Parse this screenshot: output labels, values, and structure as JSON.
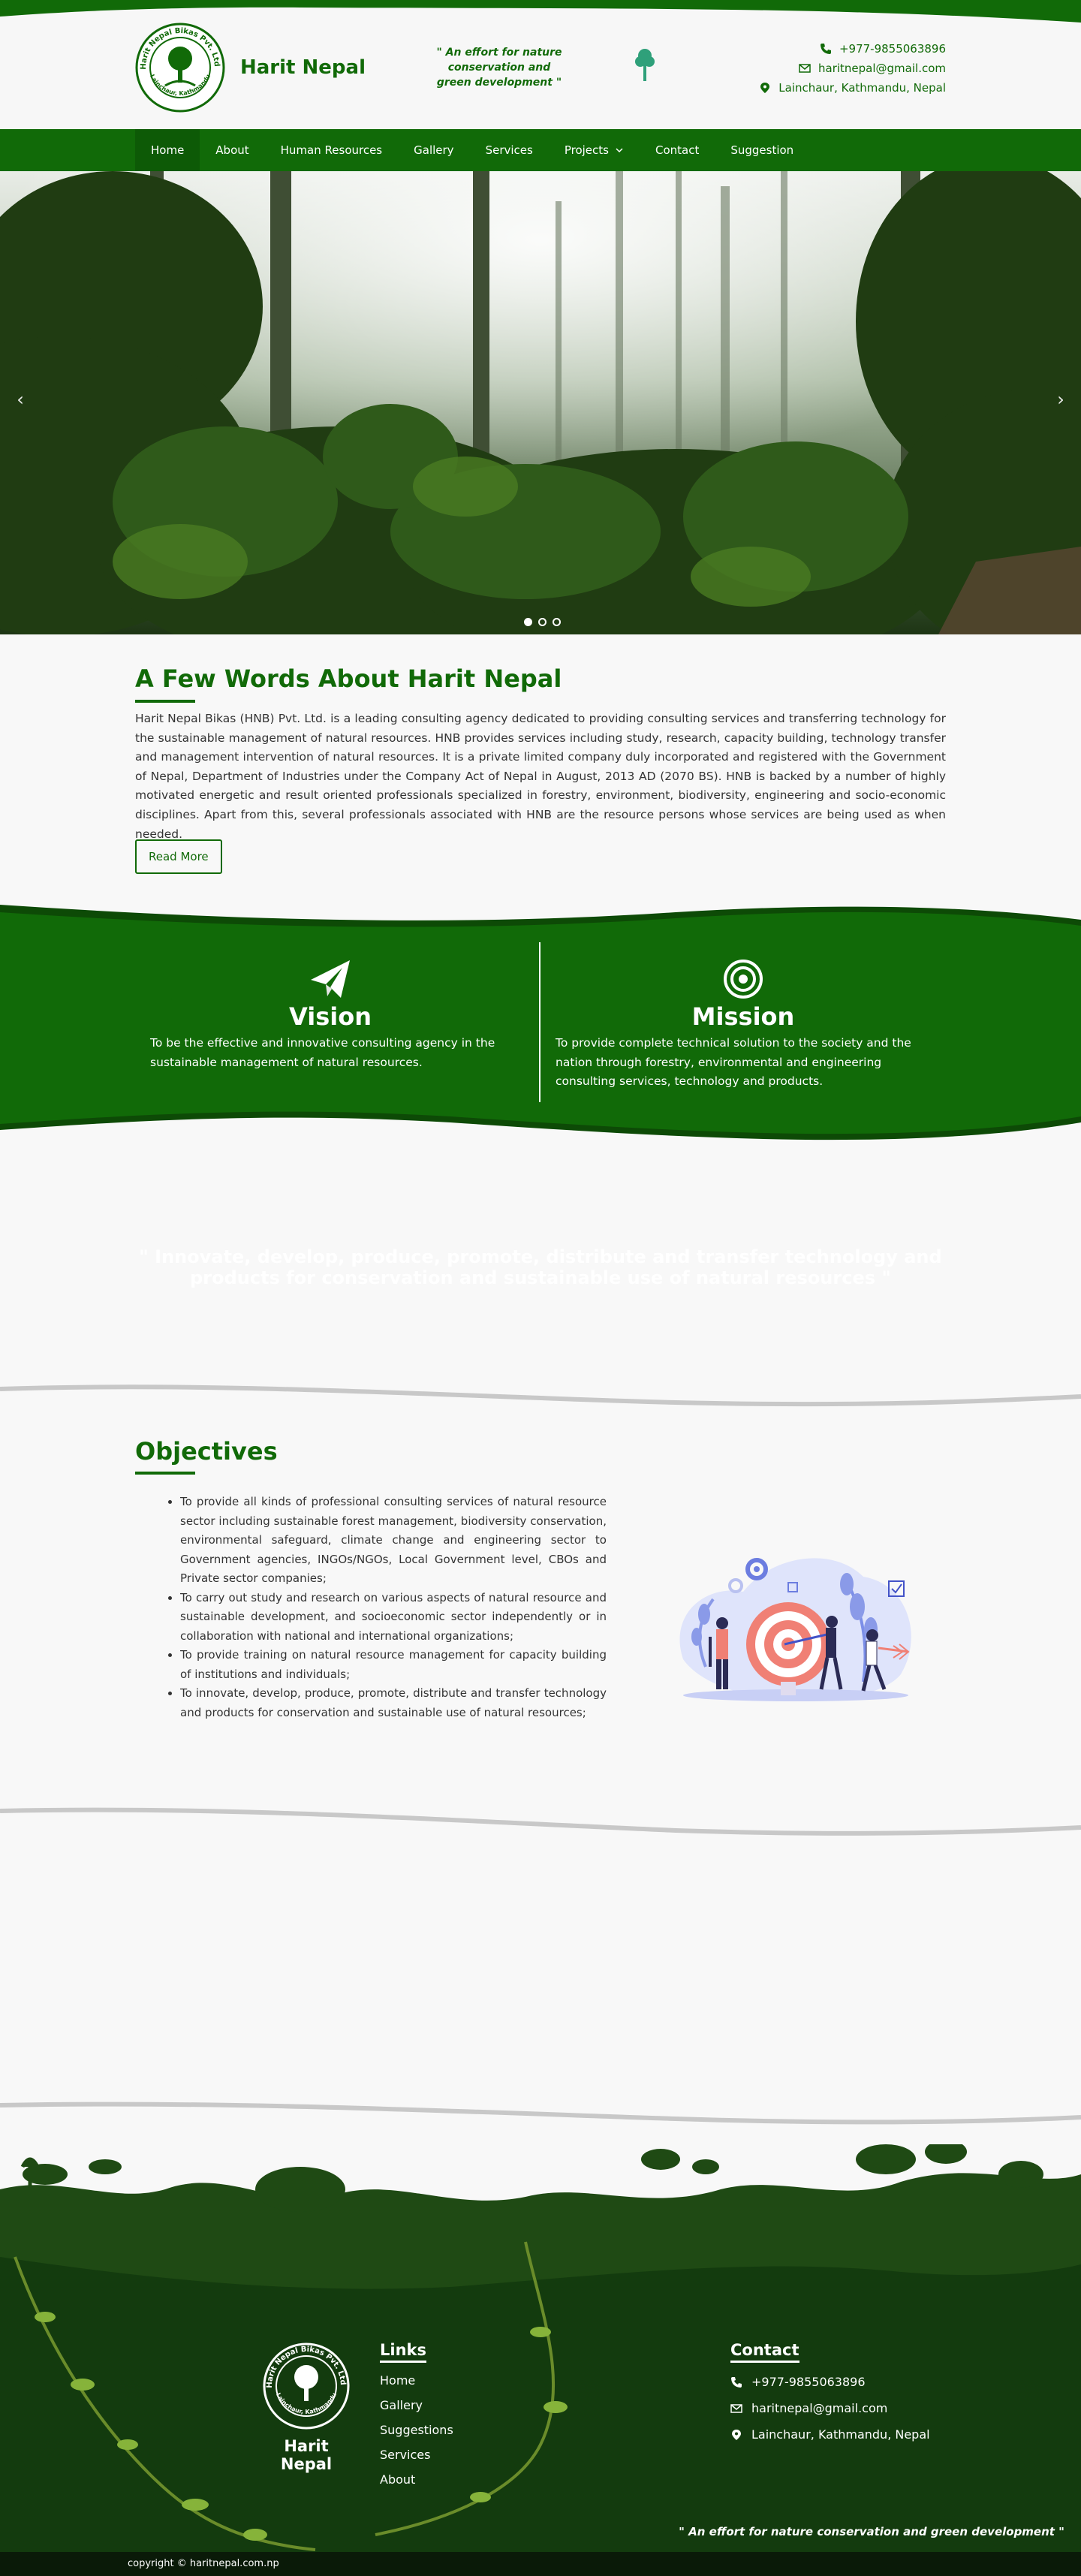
{
  "header": {
    "brand": "Harit Nepal",
    "logo_ring_text": "Harit Nepal Bikas Pvt. Ltd.",
    "logo_ring_bottom": "Lainchaur, Kathmandu",
    "tagline": "\" An effort for nature conservation and green development \"",
    "phone": "+977-9855063896",
    "email": "haritnepal@gmail.com",
    "address": "Lainchaur, Kathmandu, Nepal"
  },
  "nav": {
    "items": [
      "Home",
      "About",
      "Human Resources",
      "Gallery",
      "Services",
      "Projects",
      "Contact",
      "Suggestion"
    ]
  },
  "hero": {
    "prev": "‹",
    "next": "›"
  },
  "about": {
    "title": "A Few Words About Harit Nepal",
    "body": "Harit Nepal Bikas (HNB) Pvt. Ltd. is a leading consulting agency dedicated to providing consulting services and transferring technology for the sustainable management of natural resources. HNB provides services including study, research, capacity building, technology transfer and management intervention of natural resources. It is a private limited company duly incorporated and registered with the Government of Nepal, Department of Industries under the Company Act of Nepal in August, 2013 AD (2070 BS). HNB is backed by a number of highly motivated energetic and result oriented professionals specialized in forestry, environment, biodiversity, engineering and socio-economic disciplines. Apart from this, several professionals associated with HNB are the resource persons whose services are being used as when needed.",
    "button": "Read More"
  },
  "vision": {
    "title": "Vision",
    "text": "To be the effective and innovative consulting agency in the sustainable management of natural resources."
  },
  "mission": {
    "title": "Mission",
    "text": "To provide complete technical solution to the society and the nation through forestry, environmental and engineering consulting services, technology and products."
  },
  "quote": {
    "text": "\" Innovate, develop, produce, promote, distribute and transfer technology and products for conservation and sustainable use of natural resources \""
  },
  "objectives": {
    "title": "Objectives",
    "items": [
      "To provide all kinds of professional consulting services of natural resource sector including sustainable forest management, biodiversity conservation, environmental safeguard, climate change and engineering sector to Government agencies, INGOs/NGOs, Local Government level, CBOs and Private sector companies;",
      "To carry out study and research on various aspects of natural resource and sustainable development, and socioeconomic sector independently or in collaboration with national and international organizations;",
      "To provide training on natural resource management for capacity building of institutions and individuals;",
      "To innovate, develop, produce, promote, distribute and transfer technology and products for conservation and sustainable use of natural resources;"
    ]
  },
  "footer": {
    "brand": "Harit Nepal",
    "links_title": "Links",
    "links": [
      "Home",
      "Gallery",
      "Suggestions",
      "Services",
      "About"
    ],
    "contact_title": "Contact",
    "phone": "+977-9855063896",
    "email": "haritnepal@gmail.com",
    "address": "Lainchaur, Kathmandu, Nepal",
    "tagline": "\" An effort for nature conservation and green development \"",
    "copyright": "copyright © haritnepal.com.np"
  },
  "colors": {
    "brand_green": "#116a08",
    "dark_green": "#0f3a0c",
    "light_bg": "#f8f8f8"
  }
}
